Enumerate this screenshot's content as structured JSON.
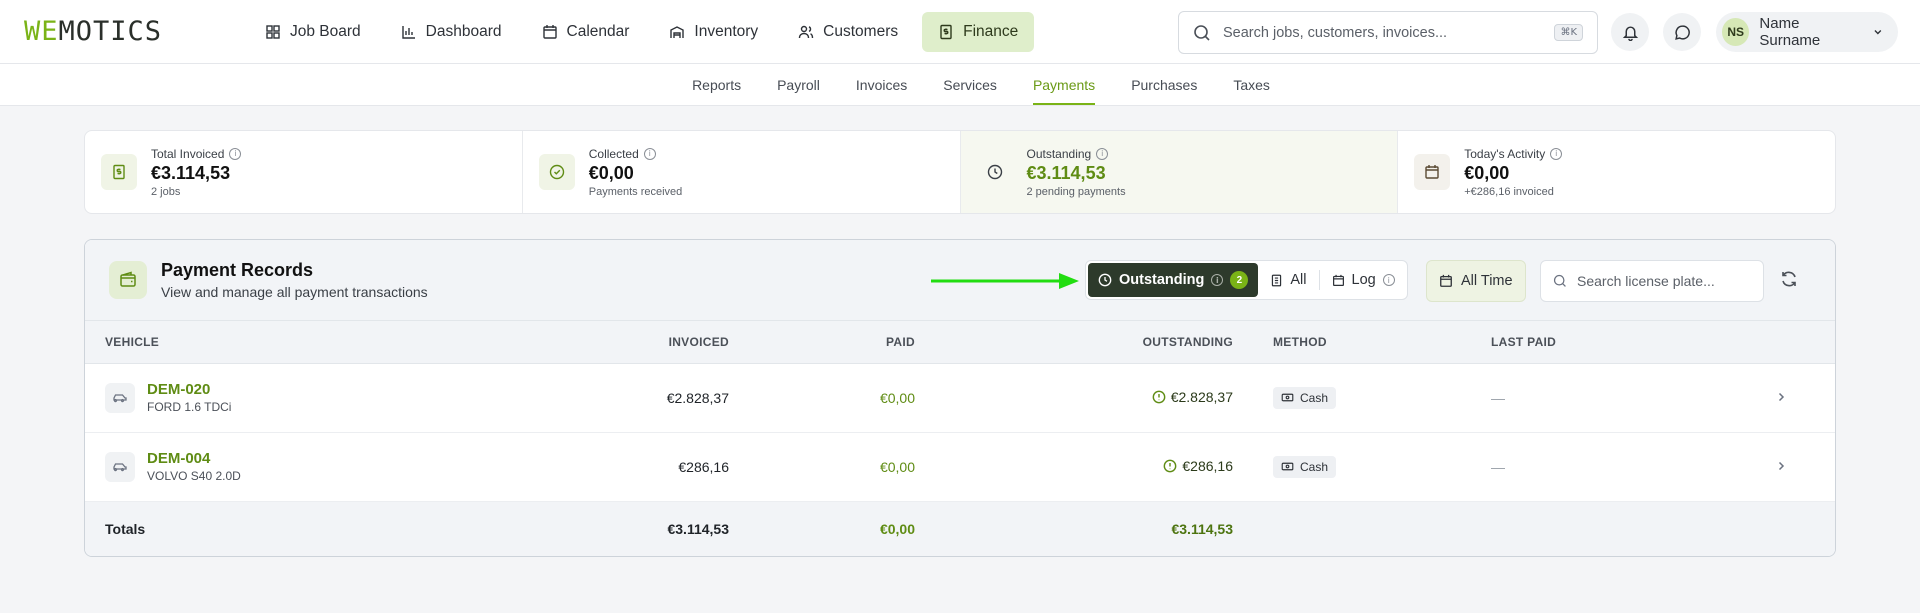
{
  "app": {
    "logo_a": "WE",
    "logo_b": "MOTICS"
  },
  "nav": [
    {
      "label": "Job Board",
      "icon": "grid-icon"
    },
    {
      "label": "Dashboard",
      "icon": "bar-chart-icon"
    },
    {
      "label": "Calendar",
      "icon": "calendar-icon"
    },
    {
      "label": "Inventory",
      "icon": "warehouse-icon"
    },
    {
      "label": "Customers",
      "icon": "users-icon"
    },
    {
      "label": "Finance",
      "icon": "dollar-doc-icon"
    }
  ],
  "search": {
    "placeholder": "Search jobs, customers, invoices...",
    "shortcut": "⌘K"
  },
  "user": {
    "initials": "NS",
    "name": "Name Surname"
  },
  "subnav": [
    "Reports",
    "Payroll",
    "Invoices",
    "Services",
    "Payments",
    "Purchases",
    "Taxes"
  ],
  "stats": [
    {
      "label": "Total Invoiced",
      "value": "€3.114,53",
      "sub": "2 jobs",
      "icon": "dollar-doc-icon"
    },
    {
      "label": "Collected",
      "value": "€0,00",
      "sub": "Payments received",
      "icon": "check-circle-icon"
    },
    {
      "label": "Outstanding",
      "value": "€3.114,53",
      "sub": "2 pending payments",
      "icon": "clock-icon"
    },
    {
      "label": "Today's Activity",
      "value": "€0,00",
      "sub": "+€286,16 invoiced",
      "icon": "calendar-icon"
    }
  ],
  "panel": {
    "title": "Payment Records",
    "subtitle": "View and manage all payment transactions",
    "filters": {
      "outstanding": "Outstanding",
      "outstanding_count": "2",
      "all": "All",
      "log": "Log"
    },
    "time": "All Time",
    "plate_placeholder": "Search license plate..."
  },
  "table": {
    "headers": {
      "vehicle": "Vehicle",
      "invoiced": "Invoiced",
      "paid": "Paid",
      "outstanding": "Outstanding",
      "method": "Method",
      "last_paid": "Last Paid"
    },
    "rows": [
      {
        "plate": "DEM-020",
        "model": "FORD 1.6 TDCi",
        "invoiced": "€2.828,37",
        "paid": "€0,00",
        "outstanding": "€2.828,37",
        "method": "Cash",
        "last_paid": "—"
      },
      {
        "plate": "DEM-004",
        "model": "VOLVO S40 2.0D",
        "invoiced": "€286,16",
        "paid": "€0,00",
        "outstanding": "€286,16",
        "method": "Cash",
        "last_paid": "—"
      }
    ],
    "totals": {
      "label": "Totals",
      "invoiced": "€3.114,53",
      "paid": "€0,00",
      "outstanding": "€3.114,53"
    }
  },
  "colors": {
    "accent": "#7ab317",
    "active_filter": "#2d3a2b",
    "arrow": "#22dd11"
  }
}
